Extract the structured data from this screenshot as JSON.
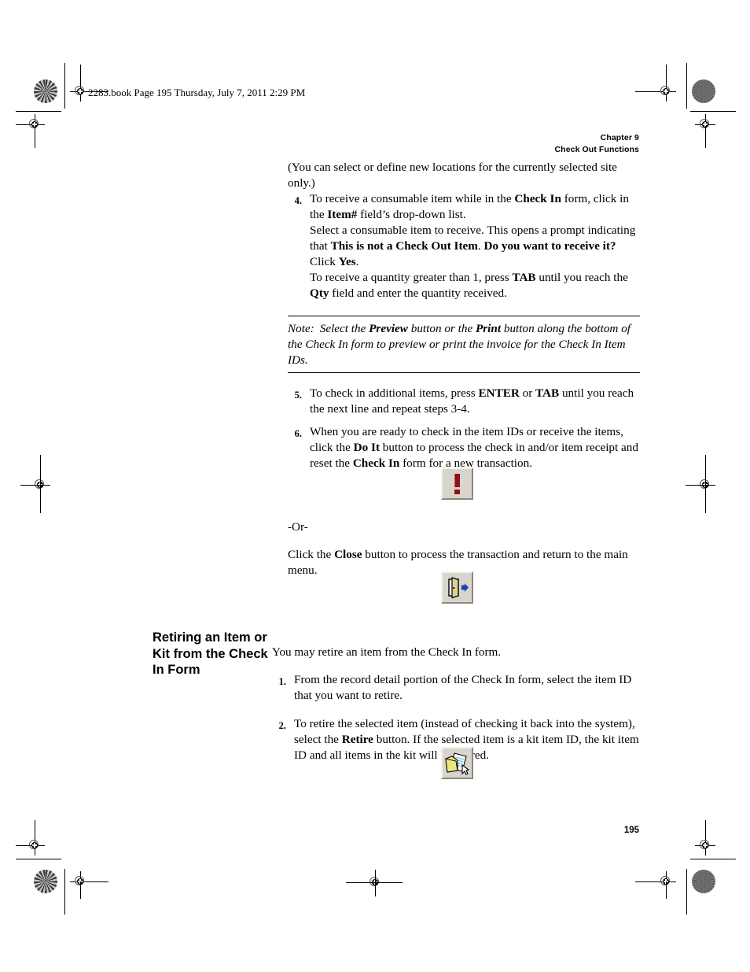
{
  "page": {
    "file_stamp": "2283.book  Page 195  Thursday, July 7, 2011  2:29 PM",
    "page_number": "195"
  },
  "running_head": {
    "line1": "Chapter 9",
    "line2": "Check Out Functions"
  },
  "body": {
    "paragraph_intro": "(You can select or define new locations for the currently selected site only.)",
    "steps": [
      {
        "number": "4.",
        "paragraphs": [
          {
            "runs": [
              {
                "text": "To receive a consumable item while in the ",
                "style": "normal"
              },
              {
                "text": "Check In",
                "style": "bold"
              },
              {
                "text": " form, click in the ",
                "style": "normal"
              },
              {
                "text": "Item#",
                "style": "bold"
              },
              {
                "text": " field’s drop-down list.",
                "style": "normal"
              }
            ]
          },
          {
            "runs": [
              {
                "text": "Select a consumable item to receive. This opens a prompt indicating that ",
                "style": "normal"
              },
              {
                "text": "This is not a Check Out Item",
                "style": "bold"
              },
              {
                "text": ". ",
                "style": "normal"
              },
              {
                "text": "Do you want to receive it?",
                "style": "bold"
              },
              {
                "text": " Click ",
                "style": "normal"
              },
              {
                "text": "Yes",
                "style": "bold"
              },
              {
                "text": ".",
                "style": "normal"
              }
            ]
          },
          {
            "runs": [
              {
                "text": "To receive a quantity greater than 1, press ",
                "style": "normal"
              },
              {
                "text": "TAB",
                "style": "bold"
              },
              {
                "text": " until you reach the ",
                "style": "normal"
              },
              {
                "text": "Qty",
                "style": "bold"
              },
              {
                "text": " field and enter the quantity received.",
                "style": "normal"
              }
            ]
          }
        ]
      }
    ],
    "note": {
      "label": "Note:",
      "runs": [
        {
          "text": "Select the ",
          "style": "italic"
        },
        {
          "text": "Preview",
          "style": "bold-italic"
        },
        {
          "text": " button or the ",
          "style": "italic"
        },
        {
          "text": "Print",
          "style": "bold-italic"
        },
        {
          "text": " button along the bottom of the Check In form to preview or print the invoice for the Check In Item IDs.",
          "style": "italic"
        }
      ]
    },
    "steps_after_note": [
      {
        "number": "5.",
        "runs": [
          {
            "text": "To check in additional items, press ",
            "style": "normal"
          },
          {
            "text": "ENTER",
            "style": "bold"
          },
          {
            "text": " or ",
            "style": "normal"
          },
          {
            "text": "TAB",
            "style": "bold"
          },
          {
            "text": " until you reach the next line and repeat steps 3-4.",
            "style": "normal"
          }
        ]
      },
      {
        "number": "6.",
        "runs": [
          {
            "text": "When you are ready to check in the item IDs or receive the items, click the ",
            "style": "normal"
          },
          {
            "text": "Do It",
            "style": "bold"
          },
          {
            "text": " button to process the check in and/or item receipt and reset the ",
            "style": "normal"
          },
          {
            "text": "Check In",
            "style": "bold"
          },
          {
            "text": " form for a new transaction.",
            "style": "normal"
          }
        ]
      }
    ],
    "or_divider": "-Or-",
    "close_paragraph": {
      "runs": [
        {
          "text": "Click the ",
          "style": "normal"
        },
        {
          "text": "Close",
          "style": "bold"
        },
        {
          "text": " button to process the transaction and return to the main menu.",
          "style": "normal"
        }
      ]
    }
  },
  "section": {
    "side_heading": "Retiring an Item or Kit from the Check In Form",
    "intro": "You may retire an item from the Check In form.",
    "steps": [
      {
        "number": "1.",
        "runs": [
          {
            "text": "From the record detail portion of the Check In form, select the item ID that you want to retire.",
            "style": "normal"
          }
        ]
      },
      {
        "number": "2.",
        "runs": [
          {
            "text": "To retire the selected item (instead of checking it back into the system), select the ",
            "style": "normal"
          },
          {
            "text": "Retire",
            "style": "bold"
          },
          {
            "text": " button. If the selected item is a kit item ID, the kit item ID and all items in the kit will be retired.",
            "style": "normal"
          }
        ]
      }
    ]
  },
  "buttons": {
    "do_it": {
      "icon": "exclamation-icon",
      "name": "Do It"
    },
    "close": {
      "icon": "exit-door-icon",
      "name": "Close"
    },
    "retire": {
      "icon": "folder-document-icon",
      "name": "Retire"
    }
  },
  "colors": {
    "exclamation_red": "#8c1318",
    "button_face": "#d9d5cd",
    "door_yellow": "#d8d39a",
    "arrow_blue": "#1a3fb8",
    "folder_yellow": "#f2ef9a",
    "doc_blue": "#aee0f0"
  }
}
